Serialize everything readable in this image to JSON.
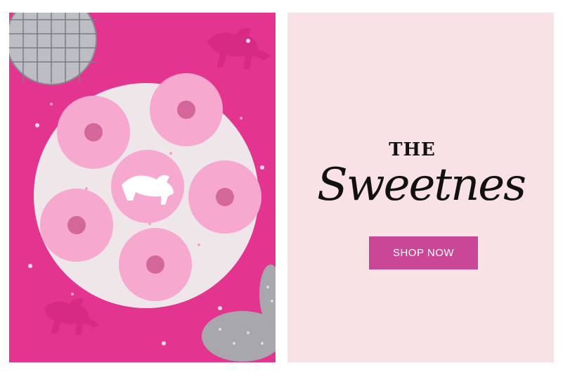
{
  "photo": {
    "alt": "Pink frosted donuts with sprinkles on a white plate, pink unicorn toys, disco ball and glitter shoes"
  },
  "brand": {
    "the_word": "THE",
    "script_word": "Sweetnes"
  },
  "cta": {
    "label": "SHOP NOW"
  },
  "colors": {
    "photo_background": "#e3358f",
    "panel_background": "#f8e2e6",
    "button_background": "#c94795",
    "button_text": "#ffffff",
    "heading_text": "#111111"
  }
}
